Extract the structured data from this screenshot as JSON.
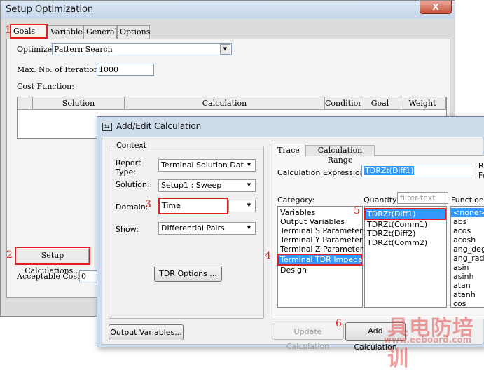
{
  "setup_window": {
    "title": "Setup Optimization",
    "close_glyph": "X",
    "tabs": [
      "Goals",
      "Variables",
      "General",
      "Options"
    ],
    "optimizer_label": "Optimizer:",
    "optimizer_value": "Pattern Search",
    "max_iter_label": "Max. No. of Iterations:",
    "max_iter_value": "1000",
    "cost_function_label": "Cost Function:",
    "cost_columns": [
      "Solution",
      "Calculation",
      "Condition",
      "Goal",
      "Weight"
    ],
    "setup_calc_button": "Setup Calculations...",
    "acceptable_cost_label": "Acceptable Cost:",
    "acceptable_cost_value": "0"
  },
  "calc_window": {
    "title": "Add/Edit Calculation",
    "context_group": "Context",
    "report_type_label": "Report Type:",
    "report_type_value": "Terminal Solution Data",
    "solution_label": "Solution:",
    "solution_value": "Setup1 : Sweep",
    "domain_label": "Domain:",
    "domain_value": "Time",
    "show_label": "Show:",
    "show_value": "Differential Pairs",
    "tdr_options_button": "TDR Options ...",
    "output_variables_button": "Output Variables...",
    "tabs": [
      "Trace",
      "Calculation Range"
    ],
    "calc_expr_label": "Calculation Expression :",
    "calc_expr_value": "TDRZt(Diff1)",
    "right_clip_1": "Ra",
    "right_clip_2": "Fu",
    "category_label": "Category:",
    "categories": [
      "Variables",
      "Output Variables",
      "Terminal S Parameter",
      "Terminal Y Parameter",
      "Terminal Z Parameter",
      "Terminal TDR Impedanc",
      "Design"
    ],
    "selected_category": "Terminal TDR Impedanc",
    "quantity_label": "Quantity:",
    "quantity_filter_placeholder": "filter-text",
    "quantities": [
      "TDRZt(Diff1)",
      "TDRZt(Comm1)",
      "TDRZt(Diff2)",
      "TDRZt(Comm2)"
    ],
    "function_label": "Function:",
    "functions": [
      "<none>",
      "abs",
      "acos",
      "acosh",
      "ang_deg",
      "ang_rad",
      "asin",
      "asinh",
      "atan",
      "atanh",
      "cos"
    ],
    "update_button": "Update Calculation",
    "add_button": "Add Calculation"
  },
  "annotations": [
    "1",
    "2",
    "3",
    "4",
    "5",
    "6"
  ],
  "watermark": {
    "chinese": "具电防培训",
    "url": "www.eeboard.com"
  },
  "colors": {
    "highlight": "#3399ff",
    "annotation_red": "#e02020",
    "title_bar": "#cfdcec"
  }
}
